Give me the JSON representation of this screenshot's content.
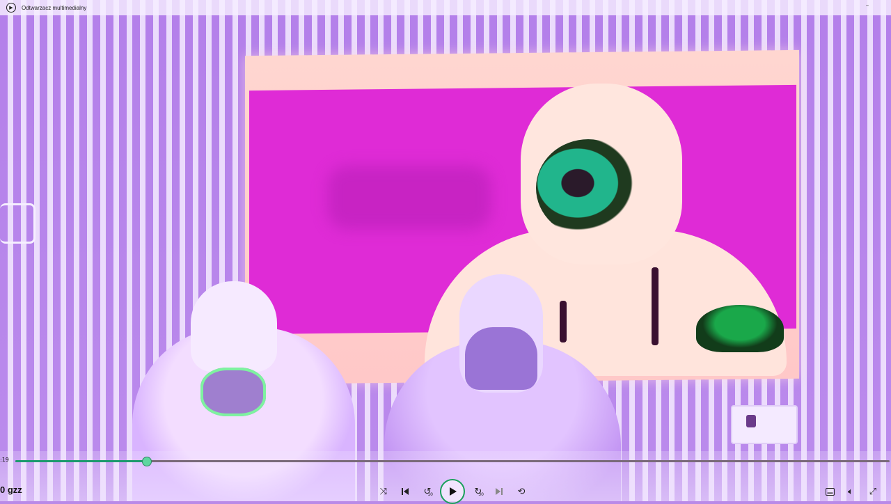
{
  "window": {
    "title": "Odtwarzacz multimedialny",
    "minimize_glyph": "–"
  },
  "player": {
    "media_title": "0 gzz",
    "time_elapsed": ":19",
    "progress_fraction": 0.15,
    "rewind_seconds": "10",
    "forward_seconds": "30"
  },
  "icons": {
    "app": "play-circle-icon",
    "shuffle": "shuffle-icon",
    "previous": "previous-track-icon",
    "rewind": "rewind-10-icon",
    "play": "play-icon",
    "forward": "forward-30-icon",
    "next": "next-track-icon",
    "repeat": "repeat-icon",
    "subtitles": "subtitles-icon",
    "volume": "volume-icon",
    "fullscreen": "fullscreen-icon"
  },
  "colors": {
    "accent": "#1d9a6e",
    "play_ring": "#19a05a",
    "track": "#7a6a7a"
  }
}
